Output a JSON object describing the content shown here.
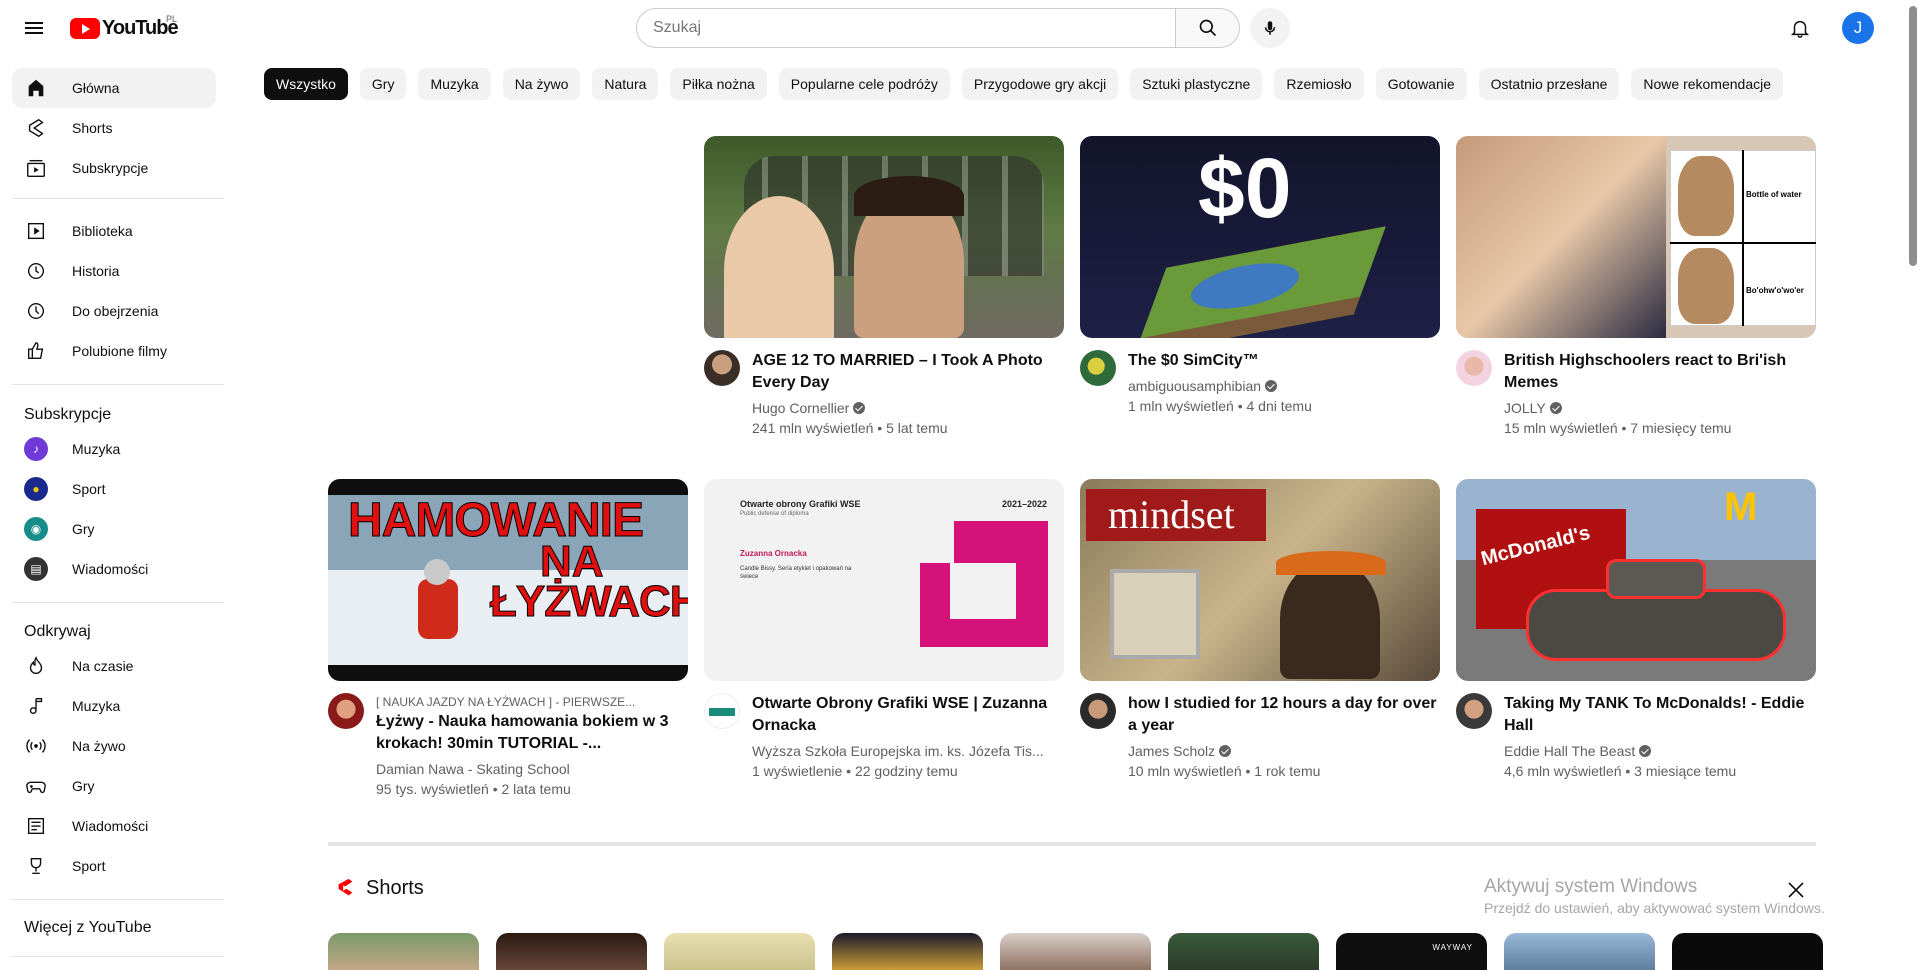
{
  "header": {
    "country_code": "PL",
    "search_placeholder": "Szukaj",
    "avatar_letter": "J"
  },
  "sidebar": {
    "main": [
      {
        "label": "Główna"
      },
      {
        "label": "Shorts"
      },
      {
        "label": "Subskrypcje"
      }
    ],
    "library": [
      {
        "label": "Biblioteka"
      },
      {
        "label": "Historia"
      },
      {
        "label": "Do obejrzenia"
      },
      {
        "label": "Polubione filmy"
      }
    ],
    "subscriptions_title": "Subskrypcje",
    "subscriptions": [
      {
        "label": "Muzyka"
      },
      {
        "label": "Sport"
      },
      {
        "label": "Gry"
      },
      {
        "label": "Wiadomości"
      }
    ],
    "explore_title": "Odkrywaj",
    "explore": [
      {
        "label": "Na czasie"
      },
      {
        "label": "Muzyka"
      },
      {
        "label": "Na żywo"
      },
      {
        "label": "Gry"
      },
      {
        "label": "Wiadomości"
      },
      {
        "label": "Sport"
      }
    ],
    "more_title": "Więcej z YouTube"
  },
  "chips": [
    "Wszystko",
    "Gry",
    "Muzyka",
    "Na żywo",
    "Natura",
    "Piłka nożna",
    "Popularne cele podróży",
    "Przygodowe gry akcji",
    "Sztuki plastyczne",
    "Rzemiosło",
    "Gotowanie",
    "Ostatnio przesłane",
    "Nowe rekomendacje"
  ],
  "videos": [
    {
      "title": "AGE 12 TO MARRIED – I Took A Photo Every Day",
      "channel": "Hugo Cornellier",
      "verified": true,
      "stats": "241 mln wyświetleń • 5 lat temu"
    },
    {
      "title": "The $0 SimCity™",
      "channel": "ambiguousamphibian",
      "verified": true,
      "stats": "1 mln wyświetleń • 4 dni temu",
      "thumb_text": "$0"
    },
    {
      "title": "British Highschoolers react to Bri'ish Memes",
      "channel": "JOLLY",
      "verified": true,
      "stats": "15 mln wyświetleń • 7 miesięcy temu",
      "thumb_text_1": "Bottle of water",
      "thumb_text_2": "Bo'ohw'o'wo'er"
    },
    {
      "kicker": "[ NAUKA JAZDY NA ŁYŻWACH ] - PIERWSZE...",
      "title": "Łyżwy - Nauka hamowania bokiem w 3 krokach! 30min TUTORIAL -...",
      "channel": "Damian Nawa - Skating School",
      "verified": false,
      "stats": "95 tys. wyświetleń • 2 lata temu",
      "thumb_line1": "HAMOWANIE",
      "thumb_line2": "NA",
      "thumb_line3": "ŁYŻWACH"
    },
    {
      "title": "Otwarte Obrony Grafiki WSE | Zuzanna Ornacka",
      "channel": "Wyższa Szkoła Europejska im. ks. Józefa Tis...",
      "verified": false,
      "stats": "1 wyświetlenie • 22 godziny temu",
      "thumb_head": "Otwarte obrony Grafiki WSE",
      "thumb_sub": "Public defense of diploma",
      "thumb_year": "2021–2022",
      "thumb_name": "Zuzanna Ornacka",
      "thumb_desc": "Candle Bissy. Seria etykiet i opakowań na świece"
    },
    {
      "title": "how I studied for 12 hours a day for over a year",
      "channel": "James Scholz",
      "verified": true,
      "stats": "10 mln wyświetleń • 1 rok temu",
      "thumb_text": "mindset"
    },
    {
      "title": "Taking My TANK To McDonalds! - Eddie Hall",
      "channel": "Eddie Hall The Beast",
      "verified": true,
      "stats": "4,6 mln wyświetleń • 3 miesiące temu",
      "thumb_text": "McDonald's"
    }
  ],
  "shorts_title": "Shorts",
  "shorts_thumb_text": "WAYWAY",
  "activate_windows": {
    "title": "Aktywuj system Windows",
    "subtitle": "Przejdź do ustawień, aby aktywować system Windows."
  }
}
